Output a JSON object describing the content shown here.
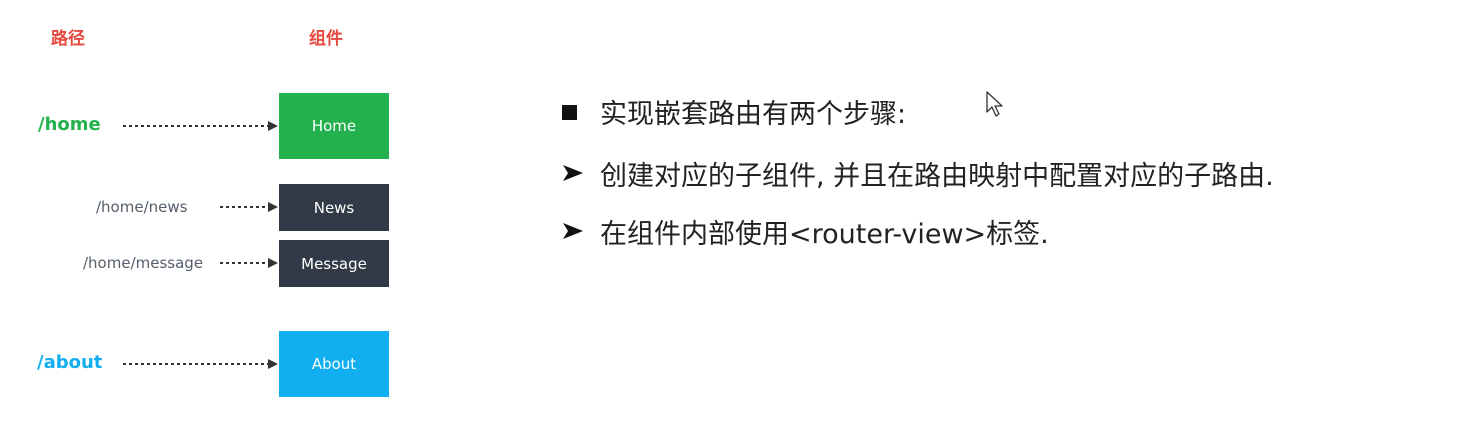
{
  "diagram": {
    "headers": {
      "path": "路径",
      "component": "组件"
    },
    "colors": {
      "header_red": "#e8493f",
      "home_green": "#22b14c",
      "child_dark": "#323a47",
      "about_blue": "#11aef0",
      "arrow": "#333333"
    },
    "rows": [
      {
        "route": "/home",
        "component": "Home"
      },
      {
        "route": "/home/news",
        "component": "News"
      },
      {
        "route": "/home/message",
        "component": "Message"
      },
      {
        "route": "/about",
        "component": "About"
      }
    ]
  },
  "notes": {
    "title": "实现嵌套路由有两个步骤:",
    "steps": [
      "创建对应的子组件, 并且在路由映射中配置对应的子路由.",
      "在组件内部使用<router-view>标签."
    ]
  }
}
